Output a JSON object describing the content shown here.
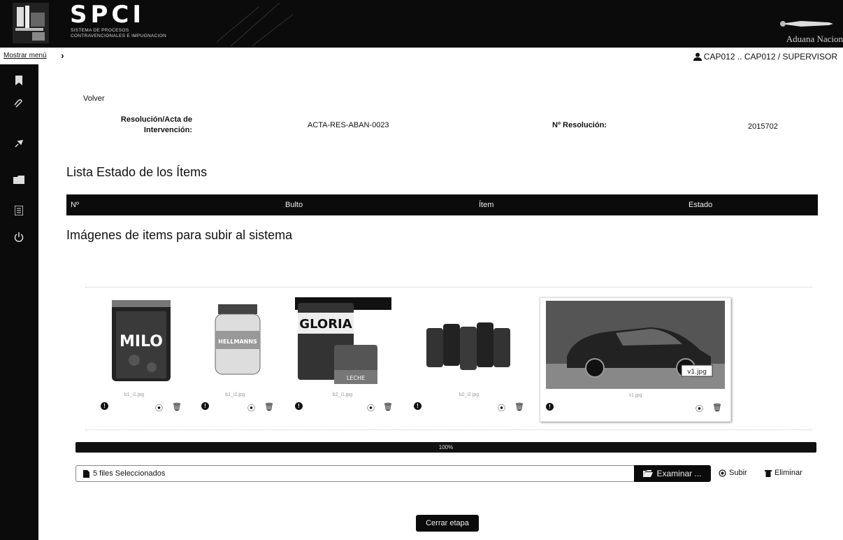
{
  "header": {
    "title": "SPCI",
    "subtitle_line1": "SISTEMA DE PROCESOS",
    "subtitle_line2": "CONTRAVENCIONALES E IMPUGNACION",
    "agency": "Aduana Nacion",
    "logo_icon": "aduana-emblem-icon"
  },
  "topbar": {
    "menu_toggle": "Mostrar menú",
    "user": "CAP012 .. CAP012 / SUPERVISOR",
    "user_icon": "user-icon"
  },
  "sidebar": {
    "icons": [
      "bookmark-icon",
      "paperclip-icon",
      "pin-icon",
      "folder-icon",
      "list-icon",
      "power-icon"
    ]
  },
  "form": {
    "back": "Volver",
    "res_label_line1": "Resolución/Acta de",
    "res_label_line2": "Intervención:",
    "res_value": "ACTA-RES-ABAN-0023",
    "nres_label": "Nº Resolución:",
    "nres_value": "2015702"
  },
  "items_section": {
    "title": "Lista Estado de los Ítems",
    "columns": [
      "Nº",
      "Bulto",
      "Ítem",
      "Estado"
    ]
  },
  "images_section": {
    "title": "Imágenes de items para subir al sistema",
    "files": [
      {
        "name": "b1_i1.jpg",
        "product": "MILO"
      },
      {
        "name": "b1_i2.jpg",
        "product": "HELLMANNS"
      },
      {
        "name": "b2_i1.jpg",
        "product": "GLORIA",
        "product_sub": "LECHE"
      },
      {
        "name": "b2_i2.jpg",
        "product": ""
      },
      {
        "name": "v1.jpg",
        "caption": "v1.jpg"
      }
    ]
  },
  "upload": {
    "progress_label": "100%",
    "progress_value": 1.0,
    "files_selected": "5 files Seleccionados",
    "browse": "Examinar ...",
    "upload": "Subir",
    "delete": "Eliminar"
  },
  "actions": {
    "close_stage": "Cerrar etapa"
  },
  "colors": {
    "dark": "#0b0b0b",
    "background": "#ffffff"
  }
}
